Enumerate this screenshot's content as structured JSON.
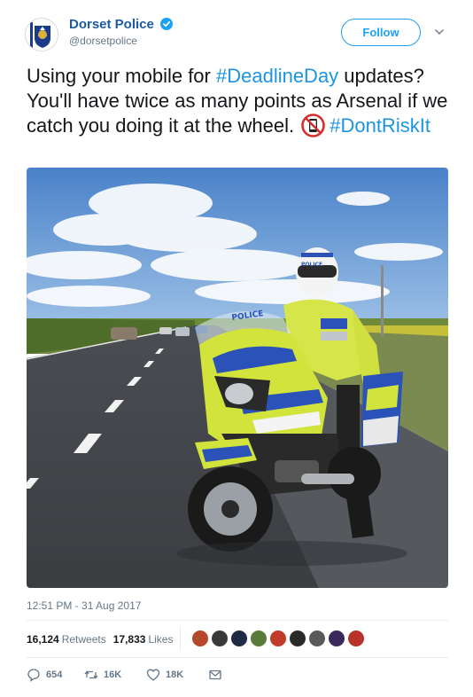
{
  "account": {
    "display_name": "Dorset Police",
    "handle": "@dorsetpolice",
    "verified": true,
    "follow_label": "Follow"
  },
  "tweet": {
    "text_part1": "Using your mobile for ",
    "hashtag1": "#DeadlineDay",
    "text_part2": " updates? You'll have twice as many points as Arsenal if we catch you doing it at the wheel.",
    "hashtag2": "#DontRiskIt",
    "emoji": "no-mobile-phones-icon",
    "timestamp": "12:51 PM - 31 Aug 2017"
  },
  "photo": {
    "vehicle_marking": "POLICE",
    "helmet_marking": "POLICE"
  },
  "stats": {
    "retweets_count": "16,124",
    "retweets_label": "Retweets",
    "likes_count": "17,833",
    "likes_label": "Likes",
    "liker_avatar_colors": [
      "#b5472a",
      "#3a3a3a",
      "#1f2a44",
      "#5a7a3a",
      "#c23a2a",
      "#2a2a2a",
      "#5a5a5a",
      "#3a2a5a",
      "#b8322a"
    ]
  },
  "actions": {
    "reply_count": "654",
    "retweet_count": "16K",
    "like_count": "18K"
  },
  "colors": {
    "brand_blue": "#1da1f2",
    "hashtag_blue": "#1b95e0",
    "name_blue": "#1c5aa0"
  }
}
